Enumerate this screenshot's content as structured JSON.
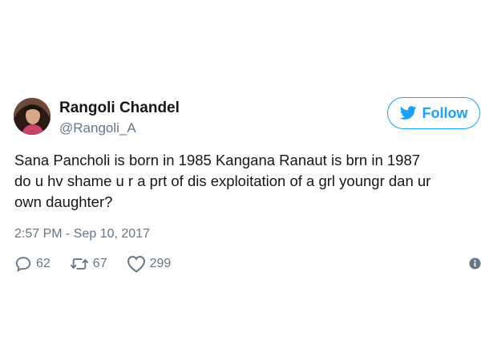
{
  "user": {
    "display_name": "Rangoli Chandel",
    "handle": "@Rangoli_A",
    "avatar": "profile-photo"
  },
  "follow_button": {
    "label": "Follow",
    "icon": "twitter-bird-icon",
    "color": "#1da1f2"
  },
  "tweet": {
    "lines": [
      "Sana Pancholi is born in 1985 Kangana Ranaut is brn in 1987",
      "do u hv shame u r a prt of dis exploitation of a grl youngr dan ur",
      "own daughter?"
    ],
    "timestamp": "2:57 PM - Sep 10, 2017"
  },
  "actions": {
    "reply": {
      "icon": "reply-icon",
      "count": "62"
    },
    "retweet": {
      "icon": "retweet-icon",
      "count": "67"
    },
    "like": {
      "icon": "heart-icon",
      "count": "299"
    },
    "info": {
      "icon": "info-icon"
    }
  },
  "colors": {
    "text": "#14171a",
    "secondary": "#657786",
    "accent": "#1da1f2"
  }
}
